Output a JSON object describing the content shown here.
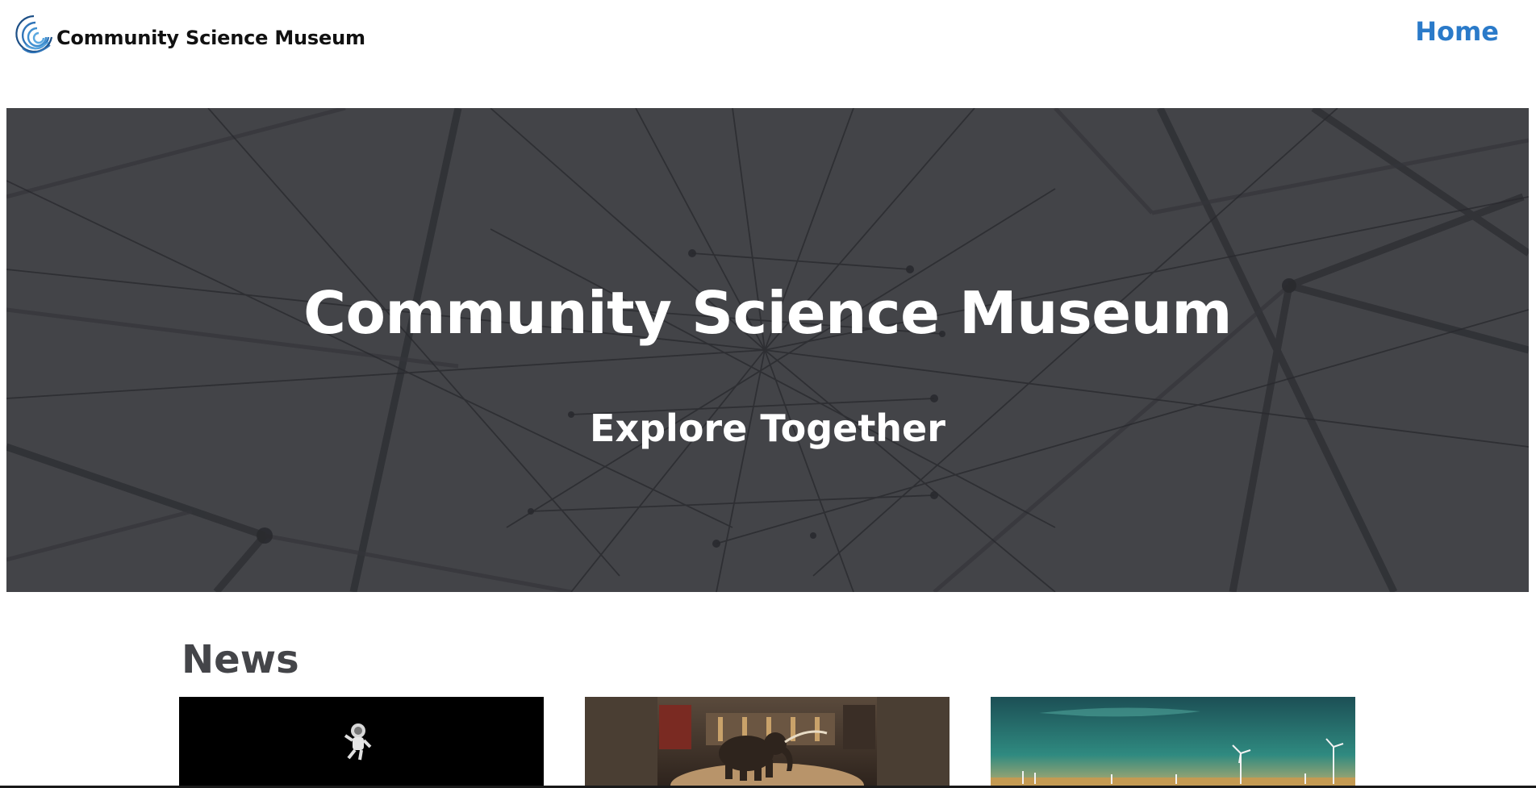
{
  "header": {
    "site_name": "Community Science Museum",
    "logo_icon": "spiral-logo-icon",
    "nav": {
      "home_label": "Home"
    }
  },
  "hero": {
    "title": "Community Science Museum",
    "subtitle": "Explore Together",
    "background": "dark-network-lines"
  },
  "news": {
    "heading": "News",
    "cards": [
      {
        "image": "astronaut-in-space"
      },
      {
        "image": "museum-elephant-exhibit"
      },
      {
        "image": "wind-turbines-field"
      }
    ]
  },
  "colors": {
    "nav_link": "#2a7ac9",
    "logo_blue": "#3f8fd0",
    "hero_bg": "#48494d",
    "heading_text": "#444549"
  }
}
